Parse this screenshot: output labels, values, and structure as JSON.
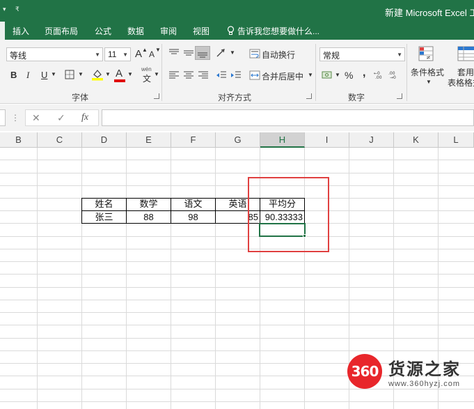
{
  "titlebar": {
    "doc_title": "新建 Microsoft Excel 工",
    "qa_arrow": "▾",
    "qa_arrow2": "₹"
  },
  "tabs": [
    "插入",
    "页面布局",
    "公式",
    "数据",
    "审阅",
    "视图"
  ],
  "tell_me": "告诉我您想要做什么...",
  "ribbon": {
    "font_name": "等线",
    "font_size": "11",
    "grow_font": "A",
    "shrink_font": "A",
    "bold": "B",
    "italic": "I",
    "underline": "U",
    "font_color_letter": "A",
    "wen": "wén",
    "wen_char": "文",
    "wrap_text": "自动换行",
    "merge_center": "合并后居中",
    "number_format": "常规",
    "percent": "%",
    "comma": ",",
    "cond_format": "条件格式",
    "table_format_1": "套用",
    "table_format_2": "表格格式",
    "group_font": "字体",
    "group_align": "对齐方式",
    "group_number": "数字"
  },
  "formula_bar": {
    "dots": "⋮",
    "cancel": "✕",
    "enter": "✓",
    "fx": "fx",
    "content": ""
  },
  "columns": [
    "B",
    "C",
    "D",
    "E",
    "F",
    "G",
    "H",
    "I",
    "J",
    "K",
    "L"
  ],
  "selected_column": "H",
  "table": {
    "headers": [
      "姓名",
      "数学",
      "语文",
      "英语",
      "平均分"
    ],
    "row": [
      "张三",
      "88",
      "98",
      "85",
      "90.33333"
    ]
  },
  "watermark": {
    "badge": "360",
    "name": "货源之家",
    "url": "www.360hyzj.com"
  },
  "colors": {
    "excel_green": "#217346",
    "annotation_red": "#e04040",
    "watermark_red": "#e8262b"
  }
}
